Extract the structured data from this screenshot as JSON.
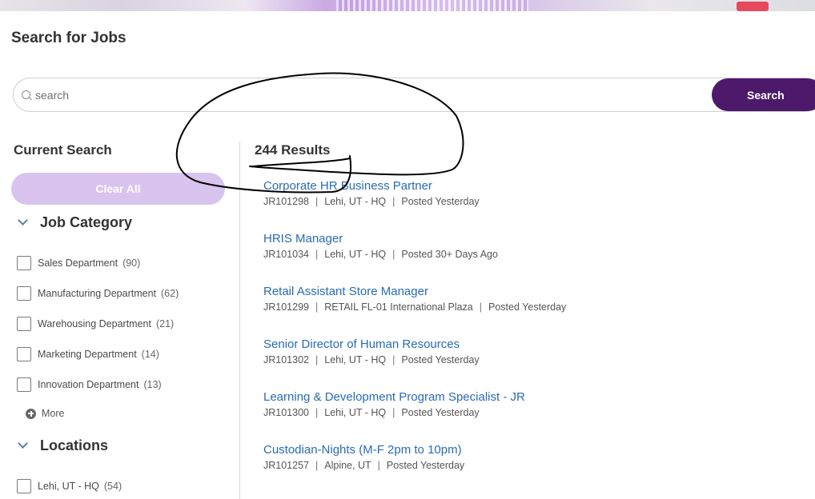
{
  "page": {
    "title": "Search for Jobs"
  },
  "search": {
    "placeholder": "search",
    "value": "",
    "button_label": "Search"
  },
  "sidebar": {
    "heading": "Current Search",
    "clear_all_label": "Clear All",
    "more_label": "More",
    "sections": [
      {
        "title": "Job Category",
        "items": [
          {
            "label": "Sales Department",
            "count": "(90)"
          },
          {
            "label": "Manufacturing Department",
            "count": "(62)"
          },
          {
            "label": "Warehousing Department",
            "count": "(21)"
          },
          {
            "label": "Marketing Department",
            "count": "(14)"
          },
          {
            "label": "Innovation Department",
            "count": "(13)"
          }
        ]
      },
      {
        "title": "Locations",
        "items": [
          {
            "label": "Lehi, UT - HQ",
            "count": "(54)"
          }
        ]
      }
    ]
  },
  "results": {
    "count_label": "244 Results",
    "jobs": [
      {
        "title": "Corporate HR Business Partner",
        "id": "JR101298",
        "location": "Lehi, UT - HQ",
        "posted": "Posted Yesterday"
      },
      {
        "title": "HRIS Manager",
        "id": "JR101034",
        "location": "Lehi, UT - HQ",
        "posted": "Posted 30+ Days Ago"
      },
      {
        "title": "Retail Assistant Store Manager",
        "id": "JR101299",
        "location": "RETAIL FL-01 International Plaza",
        "posted": "Posted Yesterday"
      },
      {
        "title": "Senior Director of Human Resources",
        "id": "JR101302",
        "location": "Lehi, UT - HQ",
        "posted": "Posted Yesterday"
      },
      {
        "title": "Learning & Development Program Specialist - JR",
        "id": "JR101300",
        "location": "Lehi, UT - HQ",
        "posted": "Posted Yesterday"
      },
      {
        "title": "Custodian-Nights (M-F 2pm to 10pm)",
        "id": "JR101257",
        "location": "Alpine, UT",
        "posted": "Posted Yesterday"
      }
    ],
    "separator": "|"
  },
  "colors": {
    "accent": "#4d1a6b",
    "clear_all_bg": "#d9c3ef",
    "link": "#2a6bb5"
  }
}
